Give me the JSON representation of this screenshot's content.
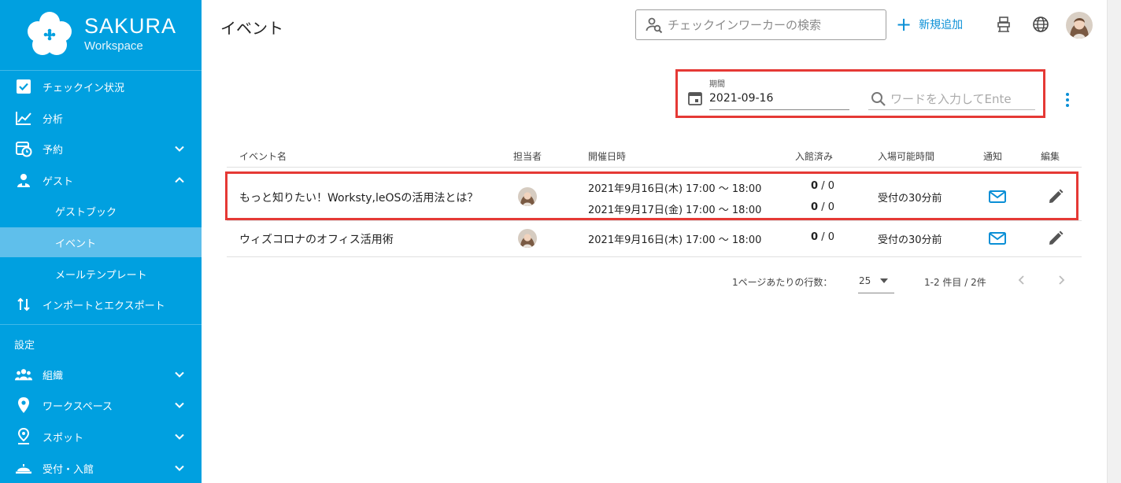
{
  "brand": {
    "name": "SAKURA",
    "sub": "Workspace"
  },
  "sidebar": {
    "items": [
      {
        "label": "チェックイン状況",
        "icon": "checkbox-icon"
      },
      {
        "label": "分析",
        "icon": "chart-line-icon"
      },
      {
        "label": "予約",
        "icon": "calendar-clock-icon"
      },
      {
        "label": "ゲスト",
        "icon": "guest-icon"
      },
      {
        "label": "ゲストブック"
      },
      {
        "label": "イベント"
      },
      {
        "label": "メールテンプレート"
      },
      {
        "label": "インポートとエクスポート",
        "icon": "import-export-icon"
      }
    ],
    "section_label": "設定",
    "settings_items": [
      {
        "label": "組織",
        "icon": "people-icon"
      },
      {
        "label": "ワークスペース",
        "icon": "location-pin-icon"
      },
      {
        "label": "スポット",
        "icon": "spot-pin-icon"
      },
      {
        "label": "受付・入館",
        "icon": "reception-bell-icon"
      }
    ]
  },
  "header": {
    "title": "イベント",
    "search_placeholder": "チェックインワーカーの検索",
    "add_label": "新規追加"
  },
  "filter": {
    "period_label": "期間",
    "period_value": "2021-09-16",
    "word_placeholder": "ワードを入力してEnte"
  },
  "table": {
    "columns": [
      "イベント名",
      "担当者",
      "開催日時",
      "入館済み",
      "入場可能時間",
      "通知",
      "編集"
    ],
    "rows": [
      {
        "name": "もっと知りたい！Worksty,leOSの活用法とは？",
        "dates": [
          {
            "datetime": "2021年9月16日(木) 17:00 〜 18:00",
            "checked_in": "0",
            "total": "/ 0"
          },
          {
            "datetime": "2021年9月17日(金) 17:00 〜 18:00",
            "checked_in": "0",
            "total": "/ 0"
          }
        ],
        "entry_time": "受付の30分前"
      },
      {
        "name": "ウィズコロナのオフィス活用術",
        "dates": [
          {
            "datetime": "2021年9月16日(木) 17:00 〜 18:00",
            "checked_in": "0",
            "total": "/ 0"
          }
        ],
        "entry_time": "受付の30分前"
      }
    ]
  },
  "pagination": {
    "rows_per_page_label": "1ページあたりの行数：",
    "rows_per_page": "25",
    "range": "1-2 件目 / 2件"
  },
  "colors": {
    "sidebar": "#00a0e0",
    "accent": "#0a8fd6",
    "highlight": "#e53935"
  }
}
